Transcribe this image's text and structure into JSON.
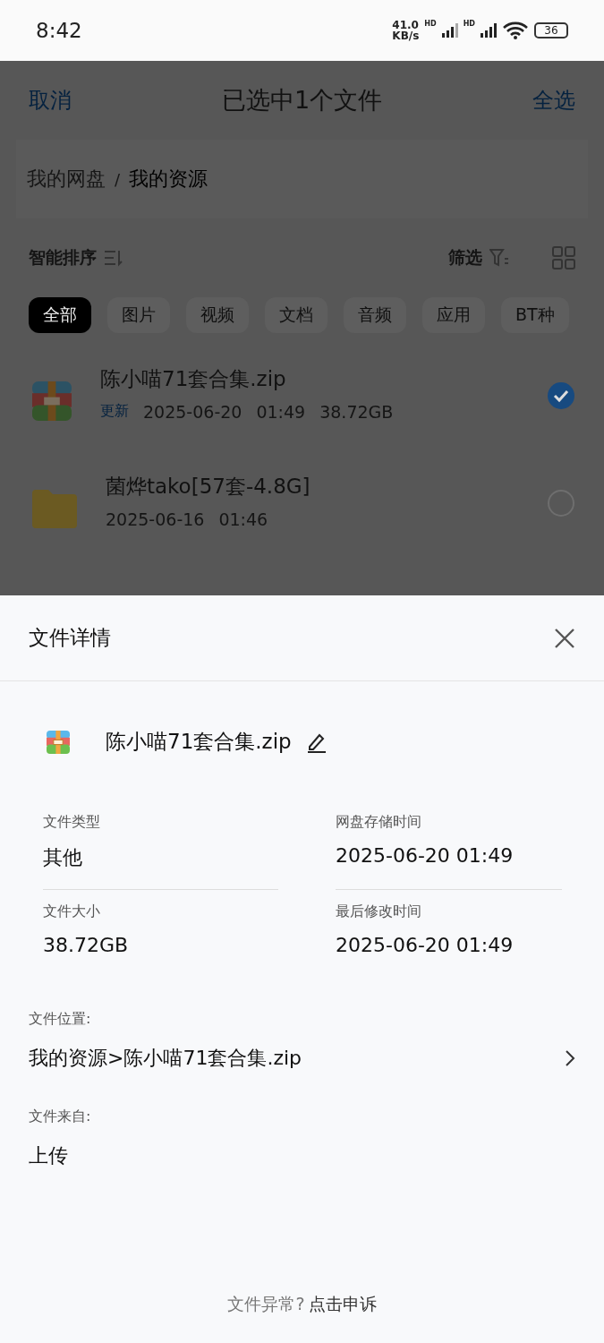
{
  "status_bar": {
    "time": "8:42",
    "speed": [
      "41.0",
      "KB/s"
    ],
    "sim_labels": [
      "HD",
      "HD"
    ],
    "battery": "36"
  },
  "header": {
    "cancel": "取消",
    "title": "已选中1个文件",
    "select_all": "全选"
  },
  "breadcrumb": [
    "我的网盘",
    "我的资源"
  ],
  "breadcrumb_separator": "/",
  "toolbar": {
    "sort": "智能排序",
    "filter": "筛选"
  },
  "categories": [
    {
      "label": "全部",
      "selected": true
    },
    {
      "label": "图片",
      "selected": false
    },
    {
      "label": "视频",
      "selected": false
    },
    {
      "label": "文档",
      "selected": false
    },
    {
      "label": "音频",
      "selected": false
    },
    {
      "label": "应用",
      "selected": false
    },
    {
      "label": "BT种",
      "selected": false
    }
  ],
  "files": [
    {
      "kind": "archive",
      "name": "陈小喵71套合集.zip",
      "tag": "更新",
      "date": "2025-06-20",
      "time": "01:49",
      "size": "38.72GB",
      "selected": true
    },
    {
      "kind": "folder",
      "name": "菌烨tako[57套-4.8G]",
      "date": "2025-06-16",
      "time": "01:46",
      "selected": false
    }
  ],
  "sheet": {
    "title": "文件详情",
    "file_name": "陈小喵71套合集.zip",
    "fields": [
      {
        "label": "文件类型",
        "value": "其他"
      },
      {
        "label": "网盘存储时间",
        "value": "2025-06-20 01:49"
      },
      {
        "label": "文件大小",
        "value": "38.72GB"
      },
      {
        "label": "最后修改时间",
        "value": "2025-06-20 01:49"
      }
    ],
    "location_label": "文件位置:",
    "location": "我的资源>陈小喵71套合集.zip",
    "source_label": "文件来自:",
    "source": "上传",
    "footer_question": "文件异常?",
    "footer_link": "点击申诉"
  }
}
